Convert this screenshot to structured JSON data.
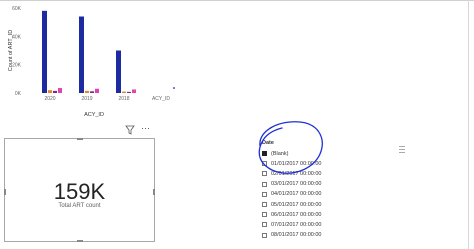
{
  "chart_data": {
    "type": "bar",
    "categories": [
      "2020",
      "2019",
      "2018",
      "ACY_ID"
    ],
    "series": [
      {
        "color": "#1c2ba0",
        "values": [
          58000,
          54000,
          30000,
          0
        ]
      },
      {
        "color": "#e8842a",
        "values": [
          2000,
          1500,
          1000,
          0
        ]
      },
      {
        "color": "#7b2b8a",
        "values": [
          1500,
          1200,
          800,
          0
        ]
      },
      {
        "color": "#e043b6",
        "values": [
          3500,
          3000,
          2500,
          0
        ]
      }
    ],
    "xlabel": "ACY_ID",
    "ylabel": "Count of ART_ID",
    "yticks": [
      "0K",
      "20K",
      "40K",
      "60K"
    ],
    "ylim": [
      0,
      60000
    ]
  },
  "kpi_card": {
    "value": "159K",
    "label": "Total ART count"
  },
  "toolbar": {
    "filter_icon": "filter-icon",
    "more_label": "···"
  },
  "slicer": {
    "title": "Date",
    "items": [
      {
        "label": "(Blank)",
        "checked": true
      },
      {
        "label": "01/01/2017 00:00:00",
        "checked": false
      },
      {
        "label": "02/01/2017 00:00:00",
        "checked": false
      },
      {
        "label": "03/01/2017 00:00:00",
        "checked": false
      },
      {
        "label": "04/01/2017 00:00:00",
        "checked": false
      },
      {
        "label": "05/01/2017 00:00:00",
        "checked": false
      },
      {
        "label": "06/01/2017 00:00:00",
        "checked": false
      },
      {
        "label": "07/01/2017 00:00:00",
        "checked": false
      },
      {
        "label": "08/01/2017 00:00:00",
        "checked": false
      }
    ]
  },
  "annotation": {
    "color": "#1d2fd6"
  }
}
